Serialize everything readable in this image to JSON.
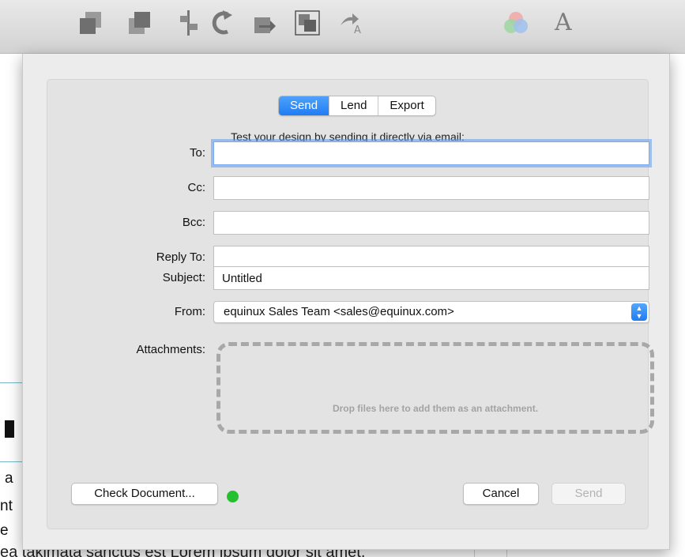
{
  "toolbar": {
    "icons": [
      "bring-forward-icon",
      "send-backward-icon",
      "align-icon",
      "rotate-icon",
      "arrow-right-icon",
      "group-icon",
      "text-arrow-icon",
      "color-wheel-icon",
      "font-icon"
    ],
    "font_icon_glyph": "A",
    "text_arrow_glyph": "A"
  },
  "document": {
    "bottom_text": "ea takimata sanctus est Lorem ipsum dolor sit amet.",
    "edge_letters": [
      "a",
      "nt",
      "e"
    ]
  },
  "tabs": [
    {
      "label": "Send",
      "active": true
    },
    {
      "label": "Lend",
      "active": false
    },
    {
      "label": "Export",
      "active": false
    }
  ],
  "intro": "Test your design by sending it directly via email:",
  "form": {
    "to_label": "To:",
    "to_value": "",
    "cc_label": "Cc:",
    "cc_value": "",
    "bcc_label": "Bcc:",
    "bcc_value": "",
    "reply_to_label": "Reply To:",
    "reply_to_value": "",
    "subject_label": "Subject:",
    "subject_value": "Untitled",
    "from_label": "From:",
    "from_value": "equinux Sales Team <sales@equinux.com>",
    "attachments_label": "Attachments:",
    "drop_hint": "Drop files here to add them as an attachment."
  },
  "footer": {
    "check_document_label": "Check Document...",
    "status_color": "#25c02f",
    "cancel_label": "Cancel",
    "send_label": "Send"
  },
  "colors": {
    "accent": "#1f7cf3",
    "focus_ring": "#609df0",
    "status_ok": "#25c02f"
  }
}
